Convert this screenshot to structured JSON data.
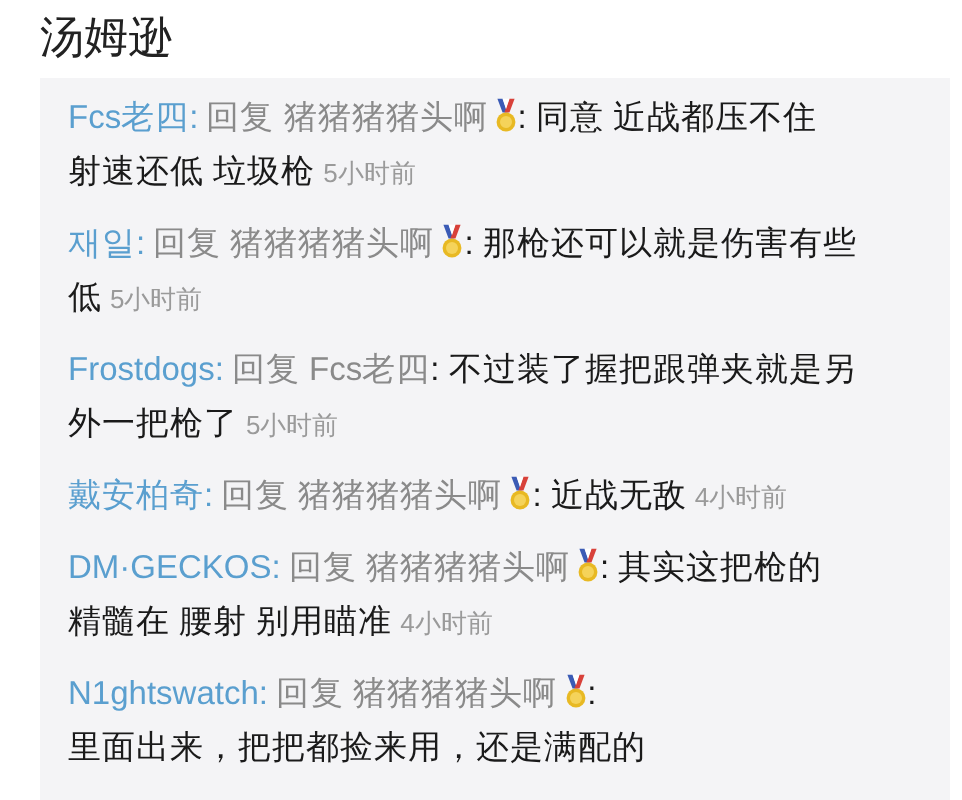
{
  "title": "汤姆逊",
  "comments": [
    {
      "author": "Fcs老四:",
      "reply_to": "回复 猪猪猪猪头啊",
      "medal": true,
      "content": ": 同意 近战都压不住",
      "continuation": "射速还低 垃圾枪",
      "time": "5小时前"
    },
    {
      "author": "재일:",
      "reply_to": "回复 猪猪猪猪头啊",
      "medal": true,
      "content": ": 那枪还可以就是伤害有些",
      "continuation": "低",
      "time": "5小时前"
    },
    {
      "author": "Frostdogs:",
      "reply_to": "回复 Fcs老四",
      "medal": false,
      "content": ": 不过装了握把跟弹夹就是另",
      "continuation": "外一把枪了",
      "time": "5小时前"
    },
    {
      "author": "戴安柏奇:",
      "reply_to": "回复 猪猪猪猪头啊",
      "medal": true,
      "content": ": 近战无敌",
      "time": "4小时前"
    },
    {
      "author": "DM·GECKOS:",
      "reply_to": "回复 猪猪猪猪头啊",
      "medal": true,
      "content": ": 其实这把枪的",
      "continuation": "精髓在 腰射 别用瞄准",
      "time": "4小时前"
    },
    {
      "author": "N1ghtswatch:",
      "reply_to": "回复 猪猪猪猪头啊",
      "medal": true,
      "content": ":",
      "continuation": "里面出来，把把都捡来用，还是满配的"
    }
  ]
}
